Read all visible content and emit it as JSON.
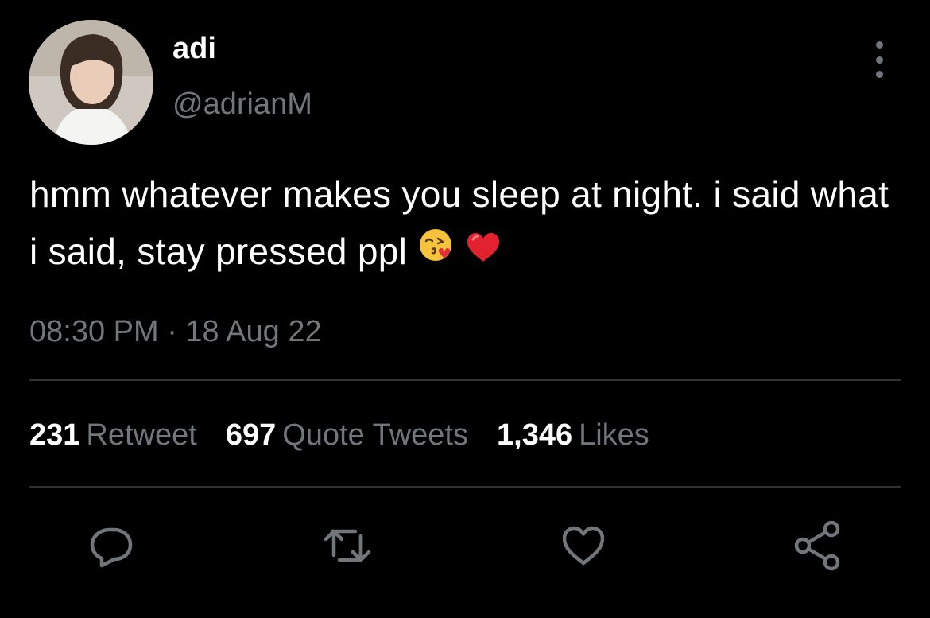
{
  "user": {
    "display_name": "adi",
    "handle": "@adrianM"
  },
  "tweet": {
    "text": "hmm whatever makes you sleep at night. i said what i said, stay pressed ppl",
    "emojis": [
      "kissing-face-with-heart-emoji",
      "red-heart-emoji"
    ],
    "timestamp": "08:30 PM · 18 Aug 22"
  },
  "stats": {
    "retweets": {
      "count": "231",
      "label": "Retweet"
    },
    "quotes": {
      "count": "697",
      "label": "Quote Tweets"
    },
    "likes": {
      "count": "1,346",
      "label": "Likes"
    }
  },
  "actions": {
    "icons": [
      "reply-icon",
      "retweet-icon",
      "like-icon",
      "share-icon"
    ]
  },
  "colors": {
    "background": "#000000",
    "primary_text": "#ffffff",
    "secondary_text": "#71767b",
    "divider": "#2f3336"
  }
}
